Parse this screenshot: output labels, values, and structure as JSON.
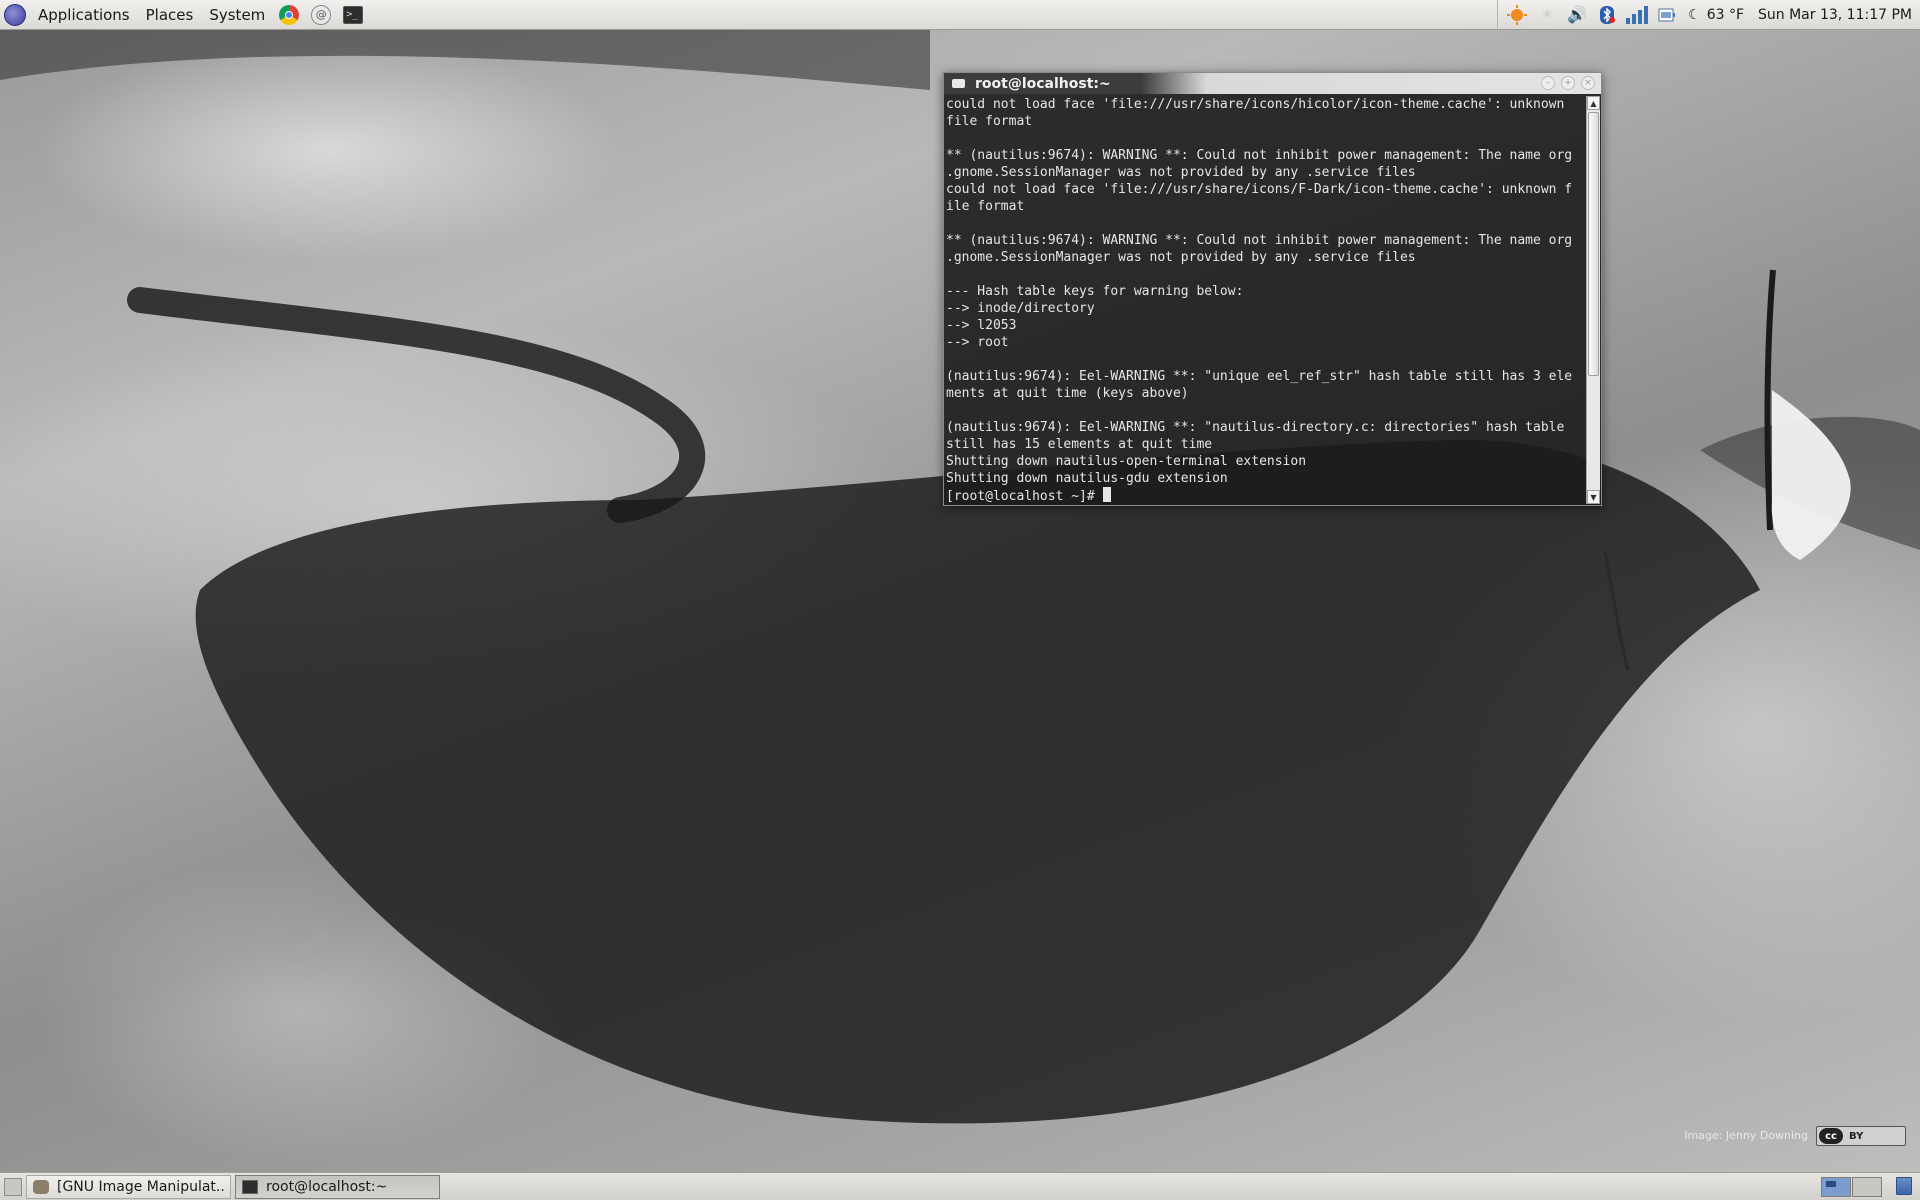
{
  "top_panel": {
    "menus": [
      "Applications",
      "Places",
      "System"
    ],
    "launchers": [
      "chrome-icon",
      "mail-icon",
      "terminal-icon"
    ],
    "tray": {
      "icons": [
        "update-icon",
        "weather-sun-icon",
        "volume-icon",
        "bluetooth-icon",
        "network-icon",
        "battery-icon"
      ],
      "weather_icon": "moon-icon",
      "temperature": "63 °F",
      "clock": "Sun Mar 13, 11:17 PM"
    }
  },
  "terminal": {
    "title": "root@localhost:~",
    "lines": [
      "could not load face 'file:///usr/share/icons/hicolor/icon-theme.cache': unknown",
      "file format",
      "",
      "** (nautilus:9674): WARNING **: Could not inhibit power management: The name org",
      ".gnome.SessionManager was not provided by any .service files",
      "could not load face 'file:///usr/share/icons/F-Dark/icon-theme.cache': unknown f",
      "ile format",
      "",
      "** (nautilus:9674): WARNING **: Could not inhibit power management: The name org",
      ".gnome.SessionManager was not provided by any .service files",
      "",
      "--- Hash table keys for warning below:",
      "--> inode/directory",
      "--> l2053",
      "--> root",
      "",
      "(nautilus:9674): Eel-WARNING **: \"unique eel_ref_str\" hash table still has 3 ele",
      "ments at quit time (keys above)",
      "",
      "(nautilus:9674): Eel-WARNING **: \"nautilus-directory.c: directories\" hash table",
      "still has 15 elements at quit time",
      "Shutting down nautilus-open-terminal extension",
      "Shutting down nautilus-gdu extension"
    ],
    "prompt": "[root@localhost ~]# "
  },
  "desktop": {
    "credit": "Image: Jenny Downing",
    "license_badge": {
      "cc": "cc",
      "by": "BY"
    }
  },
  "bottom_panel": {
    "tasks": [
      {
        "label": "[GNU Image Manipulat...",
        "icon": "gimp-icon"
      },
      {
        "label": "root@localhost:~",
        "icon": "terminal-icon"
      }
    ]
  }
}
